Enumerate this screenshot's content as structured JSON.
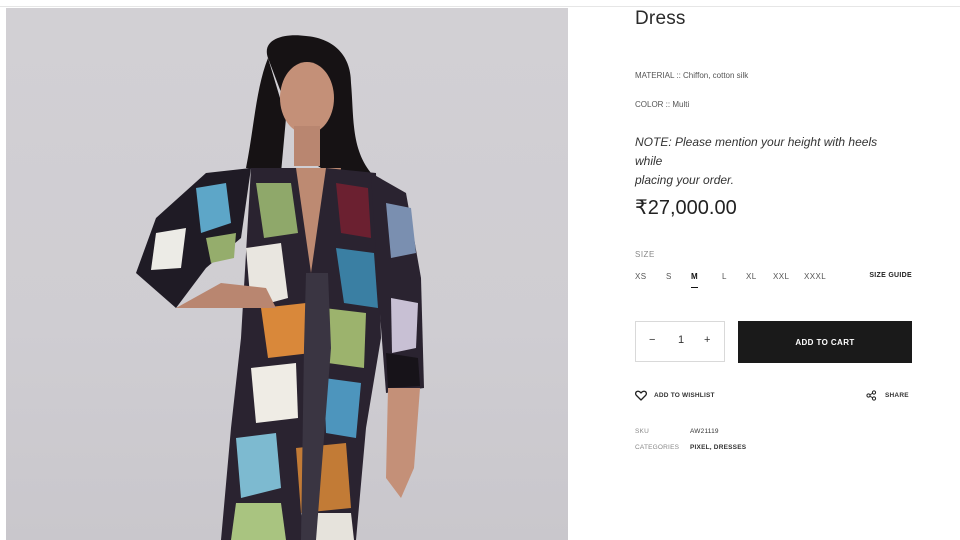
{
  "product": {
    "title": "Dress",
    "material_label": "MATERIAL :: Chiffon, cotton silk",
    "color_label": "COLOR :: Multi",
    "note_line1": "NOTE: Please mention your height with heels while",
    "note_line2": "placing your order.",
    "price": "₹27,000.00"
  },
  "size": {
    "label": "SIZE",
    "options": [
      "XS",
      "S",
      "M",
      "L",
      "XL",
      "XXL",
      "XXXL"
    ],
    "selected": "M",
    "guide_label": "SIZE GUIDE"
  },
  "quantity": {
    "minus": "−",
    "value": "1",
    "plus": "+"
  },
  "actions": {
    "add_to_cart": "ADD TO CART",
    "wishlist": "ADD TO WISHLIST",
    "share": "SHARE"
  },
  "specs": {
    "sku_label": "SKU",
    "sku_value": "AW21119",
    "categories_label": "CATEGORIES",
    "categories_value": "PIXEL, DRESSES"
  },
  "icons": {
    "wishlist": "heart-icon",
    "share": "share-icon"
  },
  "colors": {
    "cart_button": "#1a1a1a",
    "image_background": "#d0ced3"
  }
}
